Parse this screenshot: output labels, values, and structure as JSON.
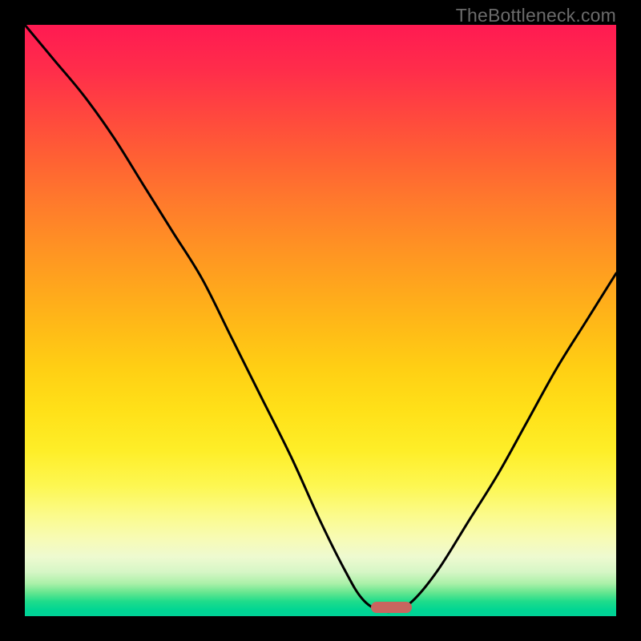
{
  "watermark_text": "TheBottleneck.com",
  "chart_data": {
    "type": "line",
    "title": "",
    "xlabel": "",
    "ylabel": "",
    "xlim": [
      0,
      100
    ],
    "ylim": [
      0,
      100
    ],
    "series": [
      {
        "name": "bottleneck-curve",
        "x": [
          0,
          5,
          10,
          15,
          20,
          25,
          30,
          35,
          40,
          45,
          50,
          54,
          57,
          60,
          63,
          66,
          70,
          75,
          80,
          85,
          90,
          95,
          100
        ],
        "y": [
          100,
          94,
          88,
          81,
          73,
          65,
          57,
          47,
          37,
          27,
          16,
          8,
          3,
          1,
          1,
          3,
          8,
          16,
          24,
          33,
          42,
          50,
          58
        ]
      }
    ],
    "bottleneck_marker": {
      "center_x": 62,
      "width": 7,
      "y": 1.5
    },
    "background_gradient": {
      "orientation": "vertical",
      "stops": [
        {
          "pos": 0.0,
          "color": "#ff1a52"
        },
        {
          "pos": 0.3,
          "color": "#ff7a2c"
        },
        {
          "pos": 0.6,
          "color": "#ffe018"
        },
        {
          "pos": 0.85,
          "color": "#f7fbb6"
        },
        {
          "pos": 0.95,
          "color": "#66e690"
        },
        {
          "pos": 1.0,
          "color": "#00d297"
        }
      ]
    }
  },
  "colors": {
    "frame": "#000000",
    "curve": "#000000",
    "bar": "#c9655f",
    "watermark": "#6b6b6b"
  }
}
